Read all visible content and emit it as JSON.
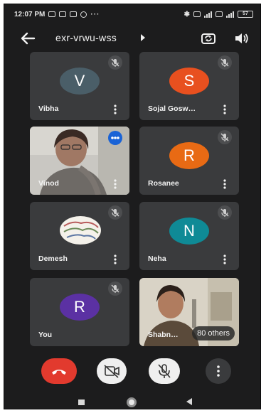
{
  "status_bar": {
    "time": "12:07 PM",
    "overflow": "···",
    "battery": "57"
  },
  "top_bar": {
    "meeting_code": "exr-vrwu-wss",
    "caret": "▸"
  },
  "tiles": [
    {
      "name": "Vibha",
      "initial": "V",
      "avatar_color": "#4a5e68",
      "muted": true
    },
    {
      "name": "Sojal Gosw…",
      "initial": "S",
      "avatar_color": "#e8501f",
      "muted": true
    },
    {
      "name": "Vinod",
      "video": true,
      "speaking": true
    },
    {
      "name": "Rosanee",
      "initial": "R",
      "avatar_color": "#e86a14",
      "muted": true
    },
    {
      "name": "Demesh",
      "photo_avatar": true,
      "muted": true
    },
    {
      "name": "Neha",
      "initial": "N",
      "avatar_color": "#0f8a96",
      "muted": true
    },
    {
      "name": "You",
      "initial": "R",
      "avatar_color": "#5b31a3",
      "muted": true
    },
    {
      "name": "Shabn…",
      "video": true,
      "others_label": "80 others"
    }
  ],
  "colors": {
    "background": "#1c1c1d",
    "tile": "#3a3b3d",
    "end_call": "#e23a2e",
    "speaking": "#1a63d6"
  },
  "icons": {
    "back": "arrow-left-icon",
    "switch_camera": "switch-camera-icon",
    "speaker": "speaker-icon",
    "mute": "mic-off-icon",
    "more": "vertical-dots-icon",
    "end_call": "phone-hangup-icon",
    "camera_off": "camera-off-icon",
    "mic_off": "mic-off-icon"
  }
}
